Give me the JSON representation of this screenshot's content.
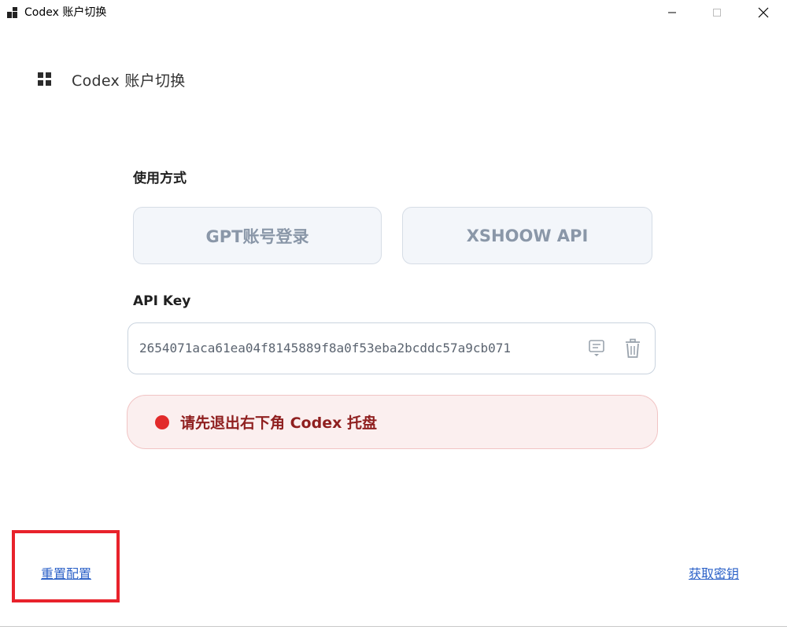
{
  "window": {
    "title": "Codex 账户切换"
  },
  "header": {
    "title": "Codex 账户切换"
  },
  "usage": {
    "label": "使用方式",
    "options": [
      {
        "label": "GPT账号登录"
      },
      {
        "label": "XSHOOW API"
      }
    ]
  },
  "api_key": {
    "label": "API Key",
    "value": "2654071aca61ea04f8145889f8a0f53eba2bcddc57a9cb071"
  },
  "alert": {
    "text": "请先退出右下角 Codex 托盘",
    "color": "#e22b2b"
  },
  "footer": {
    "reset_label": "重置配置",
    "get_key_label": "获取密钥"
  },
  "colors": {
    "accent_link": "#2d62c8",
    "highlight": "#e8222b"
  },
  "icons": {
    "app": "app-grid-icon",
    "paste": "paste-icon",
    "delete": "trash-icon"
  }
}
